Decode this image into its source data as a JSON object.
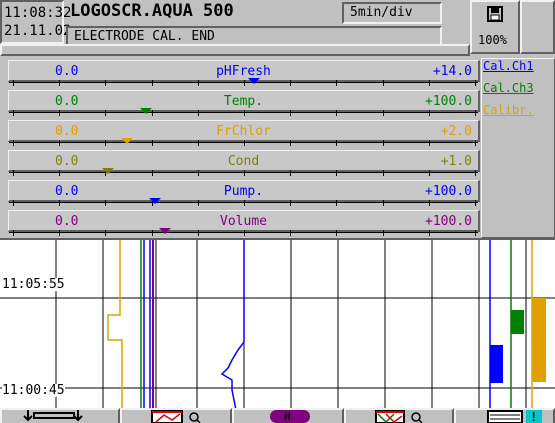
{
  "header": {
    "time": "11:08:32",
    "date": "21.11.02",
    "device_title": "LOGOSCR.AQUA 500",
    "time_base": "5min/div",
    "status_message": "ELECTRODE CAL. END",
    "memory_icon": "floppy-disk-icon",
    "memory_level": "100%"
  },
  "channels": [
    {
      "name": "pHFresh",
      "min": "0.0",
      "max": "+14.0",
      "color": "#0000ff",
      "marker_fraction": 0.52
    },
    {
      "name": "Temp.",
      "min": "0.0",
      "max": "+100.0",
      "color": "#008000",
      "marker_fraction": 0.29
    },
    {
      "name": "FrChlor",
      "min": "0.0",
      "max": "+2.0",
      "color": "#e0a000",
      "marker_fraction": 0.25
    },
    {
      "name": "Cond",
      "min": "0.0",
      "max": "+1.0",
      "color": "#808000",
      "marker_fraction": 0.21
    },
    {
      "name": "Pump.",
      "min": "0.0",
      "max": "+100.0",
      "color": "#0000ff",
      "marker_fraction": 0.31
    },
    {
      "name": "Volume",
      "min": "0.0",
      "max": "+100.0",
      "color": "#800080",
      "marker_fraction": 0.33
    }
  ],
  "side_labels": [
    {
      "text": "Cal.Ch1",
      "color": "#0000ff"
    },
    {
      "text": "Cal.Ch3",
      "color": "#008000"
    },
    {
      "text": "Calibr.",
      "color": "#e0a000"
    }
  ],
  "chart": {
    "time_labels": [
      "11:05:55",
      "11:00:45"
    ]
  },
  "footer": {
    "buttons": [
      {
        "name": "scroll-button",
        "icon": "scroll-arrows-icon"
      },
      {
        "name": "chart-zoom-button",
        "icon": "chart-magnifier-icon"
      },
      {
        "name": "hold-button",
        "icon": "hold-h-icon",
        "label": "H"
      },
      {
        "name": "chart-view-button",
        "icon": "trend-magnifier-icon"
      },
      {
        "name": "alarm-info-button",
        "icon": "info-exclamation-icon",
        "label": "!"
      }
    ]
  }
}
